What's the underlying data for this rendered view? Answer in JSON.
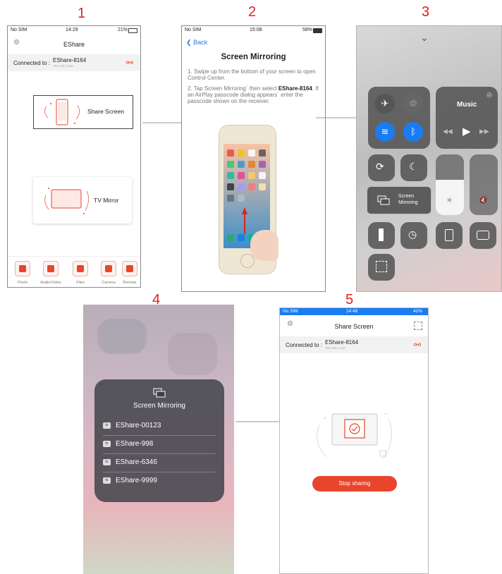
{
  "steps": [
    "1",
    "2",
    "3",
    "4",
    "5"
  ],
  "s1": {
    "status_carrier": "No SIM",
    "status_time": "14:29",
    "status_battery": "21%",
    "title": "EShare",
    "connected_label": "Connected to :",
    "device": "EShare-8164",
    "device_ip": "192.168.0.166",
    "share_screen": "Share Screen",
    "tv_mirror": "TV Mirror",
    "tabs": [
      "Photo",
      "Audio/Video",
      "Files",
      "Camera",
      "Remote"
    ]
  },
  "s2": {
    "status_carrier": "No SIM",
    "status_time": "15:08",
    "status_battery": "58%",
    "back": "Back",
    "title": "Screen Mirroring",
    "instr1": "1. Swipe up from the bottom of your screen to open Control Center.",
    "instr2_prefix": "2. Tap Screen Mirroring´ then select",
    "instr2_device": "EShare-8164",
    "instr2_suffix": ". If an AirPlay passcode dialog appears´ enter the passcode shown on the receiver."
  },
  "s3": {
    "music": "Music",
    "screen_mirroring": "Screen Mirroring"
  },
  "s4": {
    "title": "Screen Mirroring",
    "devices": [
      "EShare-00123",
      "EShare-998",
      "EShare-6346",
      "EShare-9999"
    ],
    "tv_badge": "tv"
  },
  "s5": {
    "status_carrier": "No SIM",
    "status_time": "14:48",
    "status_battery": "42%",
    "title": "Share Screen",
    "connected_label": "Connected to :",
    "device": "EShare-8164",
    "device_ip": "192.168.0.166",
    "stop_button": "Stop sharing"
  },
  "colors": {
    "accent": "#e8452c",
    "ios_blue": "#1a7cf2",
    "step_red": "#e02020"
  }
}
